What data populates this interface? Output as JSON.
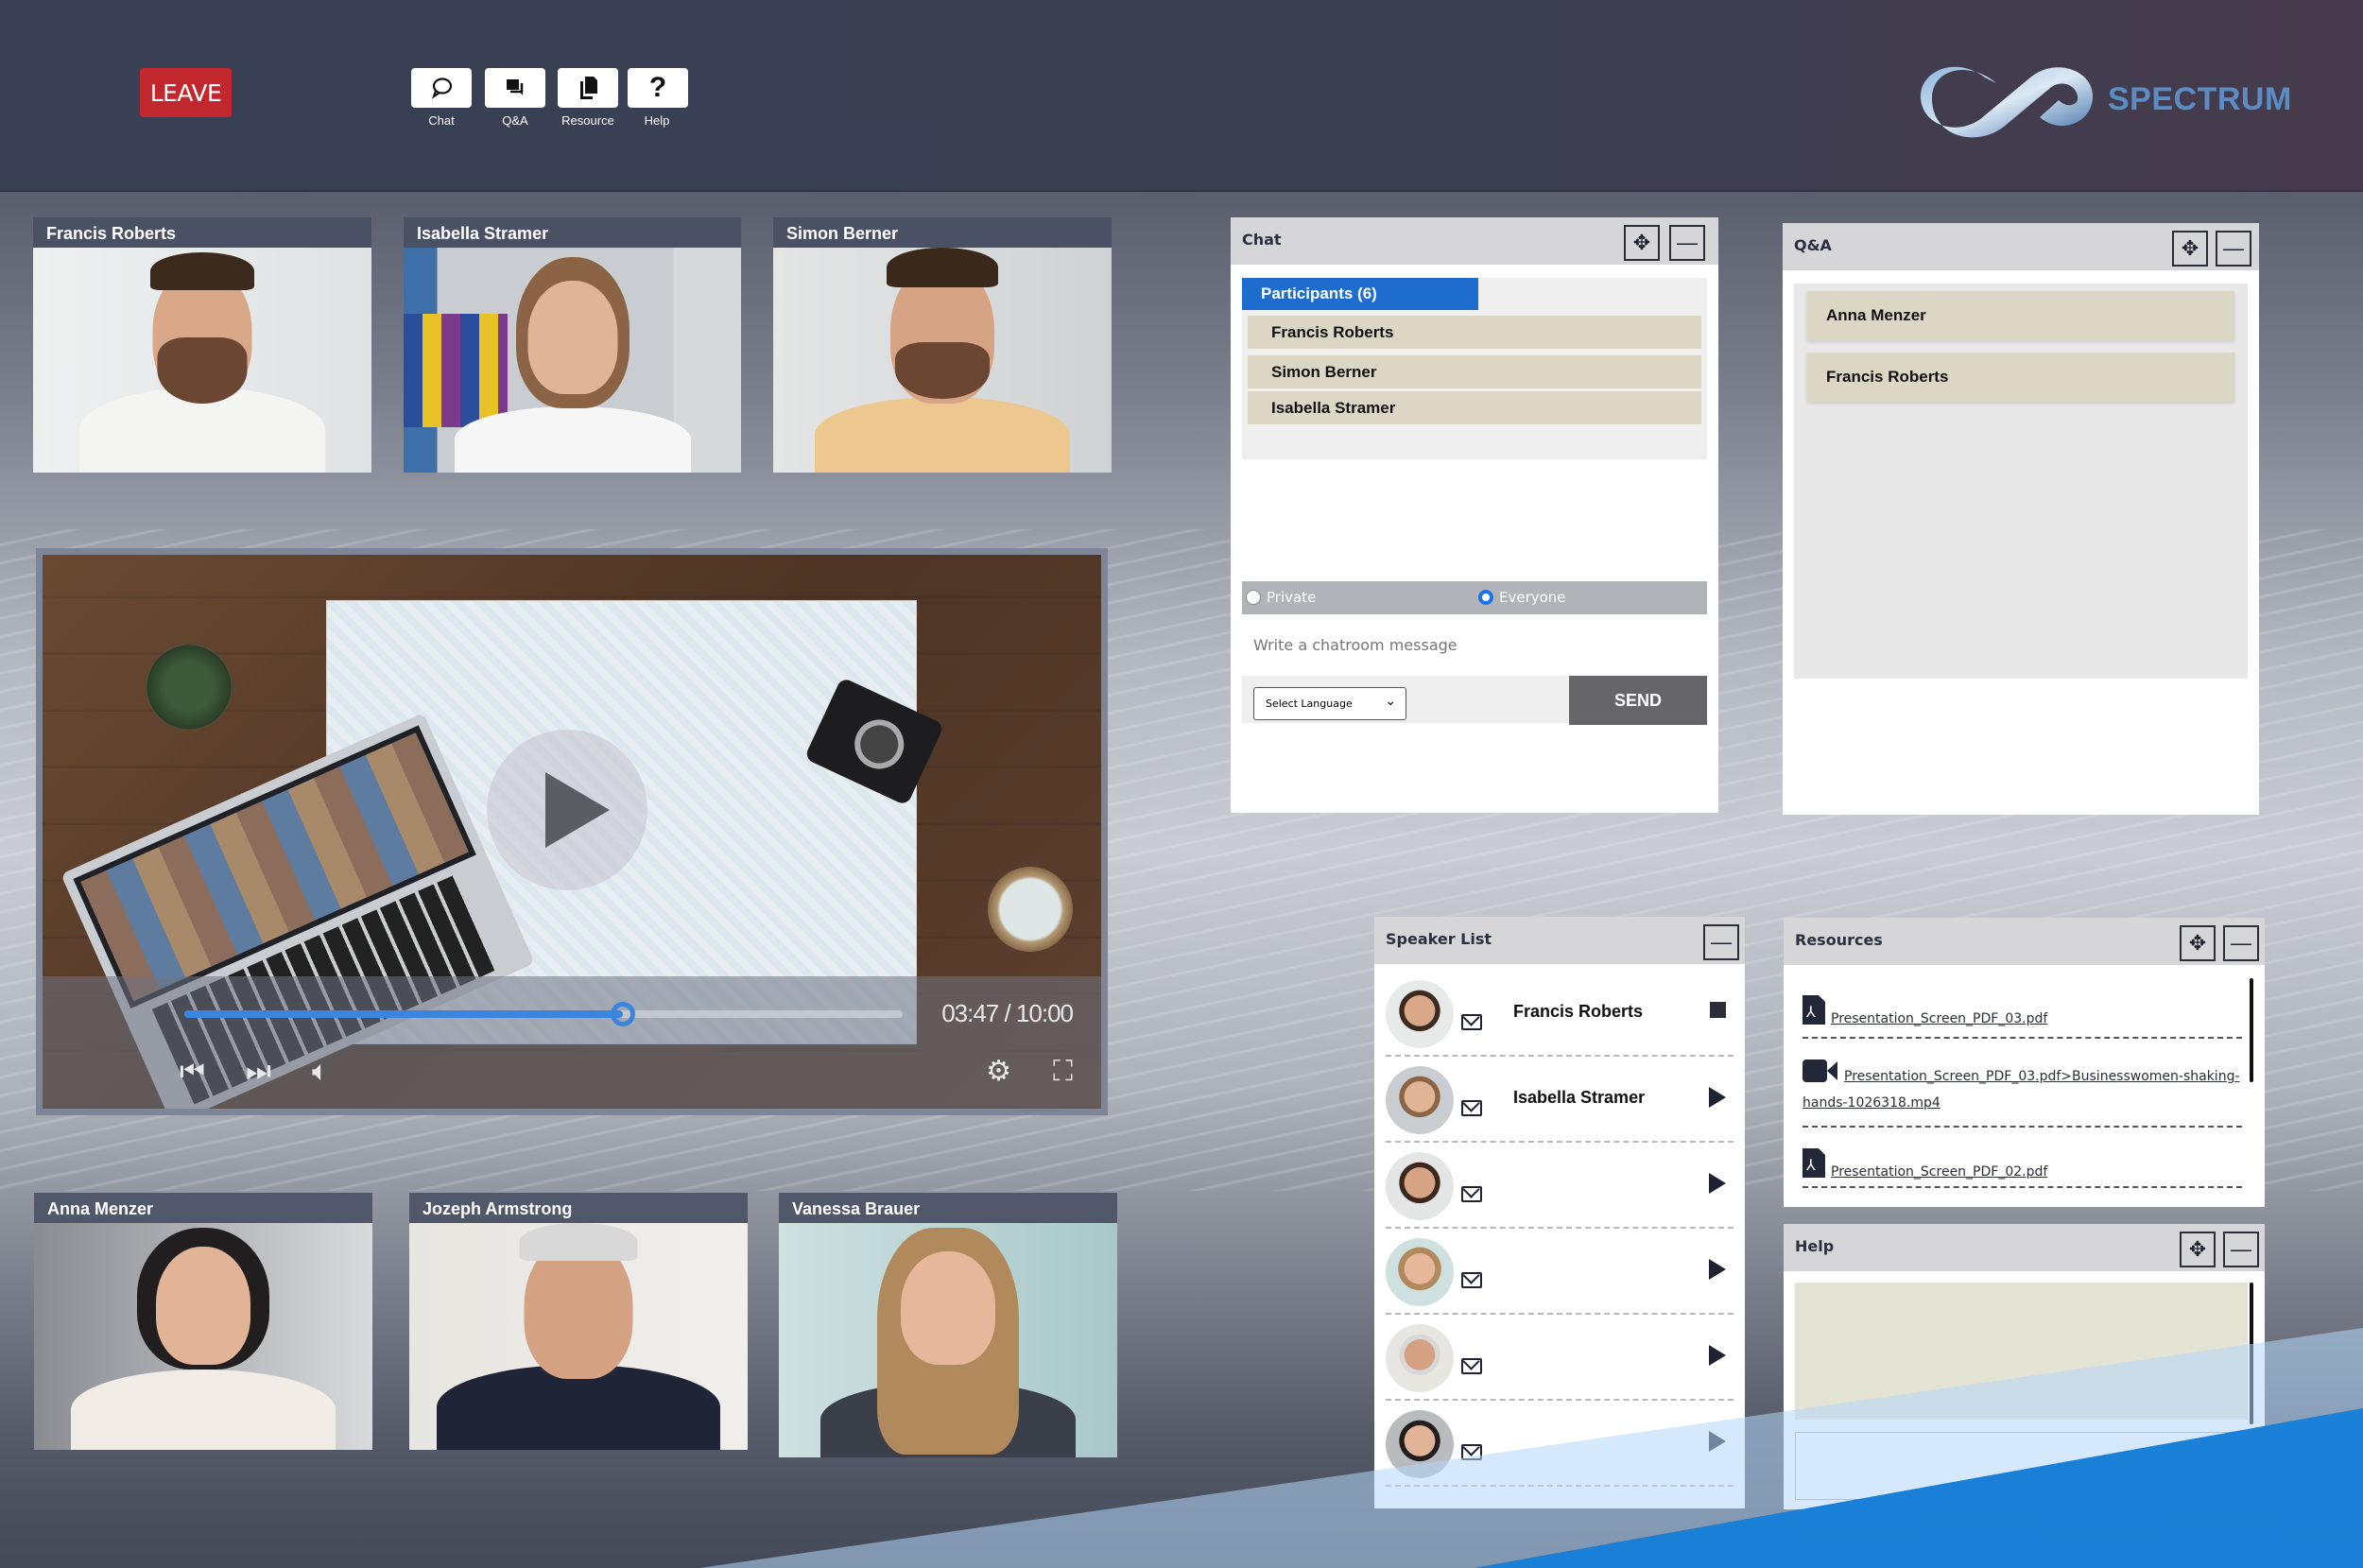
{
  "header": {
    "leave_label": "LEAVE",
    "toolbar": [
      {
        "id": "chat",
        "label": "Chat",
        "icon": "chat-bubble-icon"
      },
      {
        "id": "qa",
        "label": "Q&A",
        "icon": "qa-bubbles-icon"
      },
      {
        "id": "resource",
        "label": "Resource",
        "icon": "documents-icon"
      },
      {
        "id": "help",
        "label": "Help",
        "icon": "question-mark-icon",
        "glyph": "?"
      }
    ],
    "logo_text": "SPECTRUM"
  },
  "participants_top": [
    {
      "name": "Francis Roberts"
    },
    {
      "name": "Isabella Stramer"
    },
    {
      "name": "Simon Berner"
    }
  ],
  "participants_bottom": [
    {
      "name": "Anna Menzer"
    },
    {
      "name": "Jozeph Armstrong"
    },
    {
      "name": "Vanessa Brauer"
    }
  ],
  "video_player": {
    "current_time": "03:47",
    "duration": "10:00",
    "time_display": "03:47 / 10:00",
    "progress_fraction": 0.61,
    "state": "paused"
  },
  "chat_panel": {
    "title": "Chat",
    "participants_tab": "Participants (6)",
    "participants": [
      "Francis Roberts",
      "Simon Berner",
      "Isabella Stramer"
    ],
    "radio_private": "Private",
    "radio_everyone": "Everyone",
    "selected_audience": "Everyone",
    "message_placeholder": "Write a chatroom message",
    "language_select": "Select Language",
    "send_label": "SEND"
  },
  "qa_panel": {
    "title": "Q&A",
    "items": [
      "Anna Menzer",
      "Francis Roberts"
    ]
  },
  "speaker_list": {
    "title": "Speaker List",
    "speakers": [
      {
        "name": "Francis Roberts",
        "status": "speaking",
        "action_icon": "stop-icon"
      },
      {
        "name": "Isabella Stramer",
        "status": "queued",
        "action_icon": "play-icon"
      },
      {
        "name": "",
        "status": "queued",
        "action_icon": "play-icon"
      },
      {
        "name": "",
        "status": "queued",
        "action_icon": "play-icon"
      },
      {
        "name": "",
        "status": "queued",
        "action_icon": "play-icon"
      },
      {
        "name": "",
        "status": "queued",
        "action_icon": "play-icon"
      }
    ]
  },
  "resources_panel": {
    "title": "Resources",
    "items": [
      {
        "type": "pdf",
        "label": "Presentation_Screen_PDF_03.pdf"
      },
      {
        "type": "video",
        "label": "Presentation_Screen_PDF_03.pdf>Businesswomen-shaking-hands-1026318.mp4"
      },
      {
        "type": "pdf",
        "label": "Presentation_Screen_PDF_02.pdf"
      }
    ]
  },
  "help_panel": {
    "title": "Help"
  },
  "colors": {
    "leave": "#c1272d",
    "accent_blue": "#1f6ccf",
    "progress": "#3a85e0",
    "list_item": "#dcd7c4",
    "send_button": "#666569",
    "logo": "#5b8dc4"
  }
}
